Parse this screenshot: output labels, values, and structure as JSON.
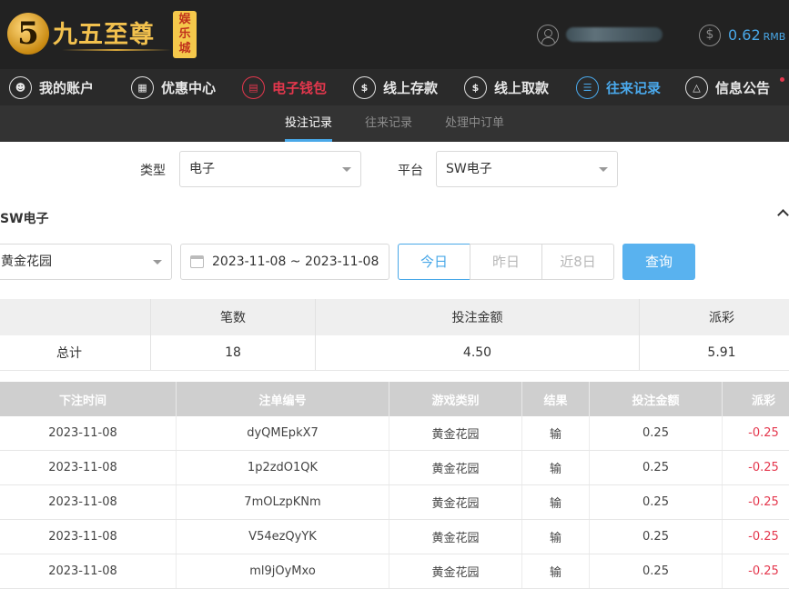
{
  "brand": {
    "logo_numeral": "5",
    "name": "九五至尊",
    "badge": "娱乐城"
  },
  "account": {
    "balance": "0.62",
    "currency": "RMB"
  },
  "nav": [
    {
      "label": "我的账户",
      "icon": "user-icon"
    },
    {
      "label": "优惠中心",
      "icon": "gift-icon"
    },
    {
      "label": "电子钱包",
      "icon": "wallet-icon"
    },
    {
      "label": "线上存款",
      "icon": "deposit-icon"
    },
    {
      "label": "线上取款",
      "icon": "withdraw-icon"
    },
    {
      "label": "往来记录",
      "icon": "record-icon"
    },
    {
      "label": "信息公告",
      "icon": "bell-icon"
    }
  ],
  "subtabs": [
    "投注记录",
    "往来记录",
    "处理中订单"
  ],
  "filters": {
    "type_label": "类型",
    "type_value": "电子",
    "platform_label": "平台",
    "platform_value": "SW电子"
  },
  "section_title": "SW电子",
  "search": {
    "game_value": "黄金花园",
    "date_range": "2023-11-08 ~ 2023-11-08",
    "quick_ranges": [
      "今日",
      "昨日",
      "近8日"
    ],
    "query_label": "查询"
  },
  "summary": {
    "headers": [
      "笔数",
      "投注金额",
      "派彩"
    ],
    "row_label": "总计",
    "count": "18",
    "bet_amount": "4.50",
    "payout": "5.91"
  },
  "details": {
    "headers": [
      "下注时间",
      "注单编号",
      "游戏类别",
      "结果",
      "投注金额",
      "派彩"
    ],
    "rows": [
      {
        "time": "2023-11-08",
        "id": "dyQMEpkX7",
        "game": "黄金花园",
        "result": "输",
        "bet": "0.25",
        "payout": "-0.25"
      },
      {
        "time": "2023-11-08",
        "id": "1p2zdO1QK",
        "game": "黄金花园",
        "result": "输",
        "bet": "0.25",
        "payout": "-0.25"
      },
      {
        "time": "2023-11-08",
        "id": "7mOLzpKNm",
        "game": "黄金花园",
        "result": "输",
        "bet": "0.25",
        "payout": "-0.25"
      },
      {
        "time": "2023-11-08",
        "id": "V54ezQyYK",
        "game": "黄金花园",
        "result": "输",
        "bet": "0.25",
        "payout": "-0.25"
      },
      {
        "time": "2023-11-08",
        "id": "ml9jOyMxo",
        "game": "黄金花园",
        "result": "输",
        "bet": "0.25",
        "payout": "-0.25"
      }
    ]
  },
  "colors": {
    "accent_blue": "#49a8e8",
    "accent_red": "#e4374d",
    "header_bg": "#222222"
  }
}
